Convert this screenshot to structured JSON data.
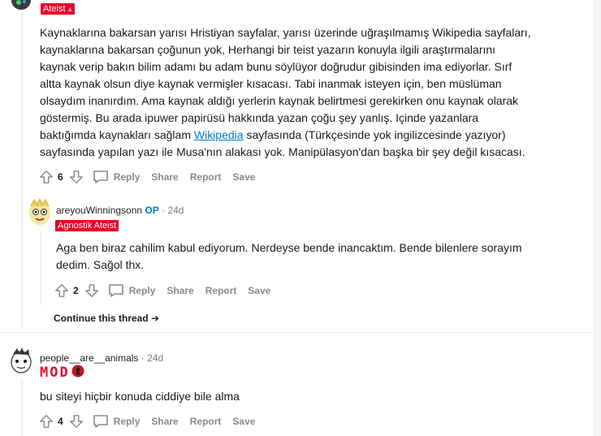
{
  "top_comment": {
    "flair": "Ateist",
    "body": [
      "Kaynaklarına bakarsan yarısı Hristiyan sayfalar, yarısı üzerinde uğraşılmamış Wikipedia sayfaları,",
      "kaynaklarına bakarsan çoğunun yok, Herhangi bir teist yazarın konuyla ilgili araştırmalarını",
      "kaynak verip bakın bilim adamı bu adam bunu söylüyor doğrudur gibisinden ima ediyorlar. Sırf",
      "altta kaynak olsun diye kaynak vermişler kısacası. Tabi inanmak isteyen için, ben müslüman",
      "olsaydım inanırdım. Ama kaynak aldığı yerlerin kaynak belirtmesi gerekirken onu kaynak olarak",
      "göstermiş. Bu arada ipuwer papirüsü hakkında yazan çoğu şey yanlış. Içinde yazanlara"
    ],
    "body_line7_before": "baktığımda kaynakları sağlam ",
    "body_link": "Wikipedia",
    "body_line7_after": " sayfasında (Türkçesinde yok ingilizcesinde yazıyor)",
    "body_line8": "sayfasında yapılan yazı ile Musa'nın alakası yok. Manipülasyon'dan başka bir şey değil kısacası.",
    "votes": "6",
    "actions": {
      "reply": "Reply",
      "share": "Share",
      "report": "Report",
      "save": "Save"
    }
  },
  "reply_comment": {
    "username": "areyouWinningsonn",
    "op_label": "OP",
    "age": "· 24d",
    "flair": "Agnostik Ateist",
    "body": [
      "Aga ben biraz cahilim kabul ediyorum. Nerdeyse bende inancaktım. Bende bilenlere sorayım",
      "dedim. Sağol thx."
    ],
    "votes": "2",
    "actions": {
      "reply": "Reply",
      "share": "Share",
      "report": "Report",
      "save": "Save"
    },
    "continue_thread": "Continue this thread"
  },
  "third_comment": {
    "username": "people__are__animals",
    "age": "· 24d",
    "flair_logo": "MOD",
    "body": "bu siteyi hiçbir konuda ciddiye bile alma",
    "votes": "4",
    "actions": {
      "reply": "Reply",
      "share": "Share",
      "report": "Report",
      "save": "Save"
    }
  },
  "colors": {
    "flair_red": "#ea0027",
    "op_blue": "#0079d3",
    "action_gray": "#878a8c"
  }
}
